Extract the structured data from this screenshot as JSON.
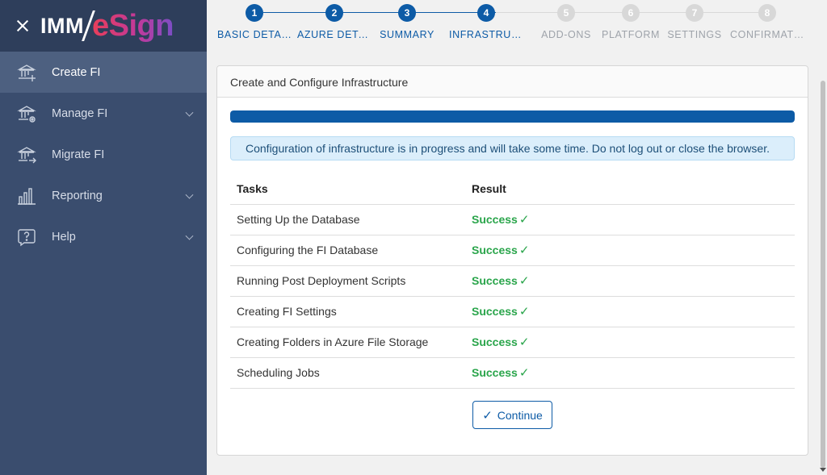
{
  "sidebar": {
    "logo_imm": "IMM",
    "logo_esign": "eSign",
    "items": [
      {
        "label": "Create FI",
        "icon": "bank-add-icon",
        "active": true
      },
      {
        "label": "Manage FI",
        "icon": "bank-settings-icon"
      },
      {
        "label": "Migrate FI",
        "icon": "bank-migrate-icon"
      },
      {
        "label": "Reporting",
        "icon": "bar-chart-icon"
      },
      {
        "label": "Help",
        "icon": "question-icon"
      }
    ]
  },
  "stepper": {
    "steps": [
      {
        "number": "1",
        "label": "BASIC DETAILS",
        "status": "done"
      },
      {
        "number": "2",
        "label": "AZURE DETAILS",
        "status": "done"
      },
      {
        "number": "3",
        "label": "SUMMARY",
        "status": "done"
      },
      {
        "number": "4",
        "label": "INFRASTRUCTURE",
        "status": "done"
      },
      {
        "number": "5",
        "label": "ADD-ONS",
        "status": "todo"
      },
      {
        "number": "6",
        "label": "PLATFORM",
        "status": "todo"
      },
      {
        "number": "7",
        "label": "SETTINGS",
        "status": "todo"
      },
      {
        "number": "8",
        "label": "CONFIRMATION",
        "status": "todo"
      }
    ]
  },
  "card": {
    "title": "Create and Configure Infrastructure",
    "progress_fraction": 1.0,
    "info_message": "Configuration of infrastructure is in progress and will take some time. Do not log out or close the browser.",
    "table": {
      "headers": [
        "Tasks",
        "Result"
      ],
      "rows": [
        {
          "task": "Setting Up the Database",
          "result": "Success"
        },
        {
          "task": "Configuring the FI Database",
          "result": "Success"
        },
        {
          "task": "Running Post Deployment Scripts",
          "result": "Success"
        },
        {
          "task": "Creating FI Settings",
          "result": "Success"
        },
        {
          "task": "Creating Folders in Azure File Storage",
          "result": "Success"
        },
        {
          "task": "Scheduling Jobs",
          "result": "Success"
        }
      ]
    },
    "continue_label": "Continue",
    "check_glyph": "✓"
  },
  "colors": {
    "primary": "#0d5ba6",
    "success": "#2aa54b",
    "sidebar_bg": "#3a4d6e",
    "sidebar_header_bg": "#2e3e5b",
    "info_bg": "#dbeefb"
  }
}
